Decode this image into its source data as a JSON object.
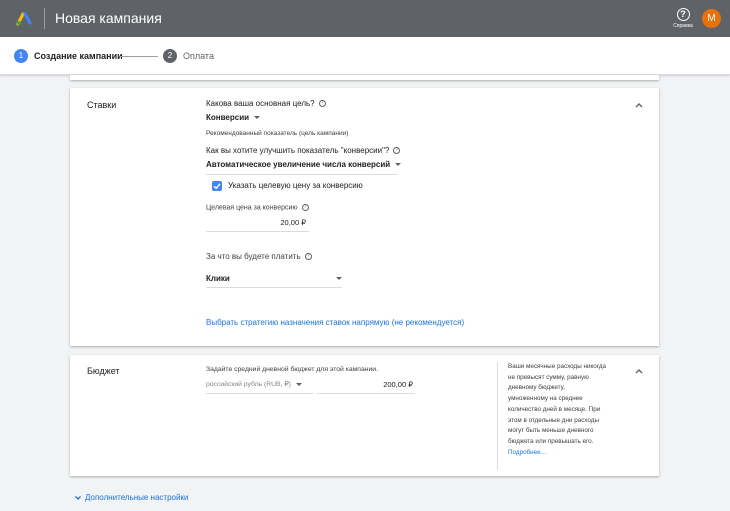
{
  "header": {
    "title": "Новая кампания",
    "help_label": "Справка",
    "avatar_letter": "M",
    "help_glyph": "?"
  },
  "stepper": {
    "steps": [
      {
        "number": "1",
        "label": "Создание кампании"
      },
      {
        "number": "2",
        "label": "Оплата"
      }
    ]
  },
  "bids": {
    "title": "Ставки",
    "goal_question": "Какова ваша основная цель?",
    "goal_value": "Конверсии",
    "recommended_label": "Рекомендованный показатель (цель кампании)",
    "improve_question": "Как вы хотите улучшить показатель \"конверсии\"?",
    "improve_value": "Автоматическое увеличение числа конверсий",
    "target_cpa_checkbox": "Указать целевую цену за конверсию",
    "target_cpa_label": "Целевая цена за конверсию",
    "target_cpa_value": "20,00 ₽",
    "pay_for_question": "За что вы будете платить",
    "pay_for_value": "Клики",
    "strategy_link": "Выбрать стратегию назначения ставок напрямую (не рекомендуется)"
  },
  "budget": {
    "title": "Бюджет",
    "prompt": "Задайте средний дневной бюджет для этой кампании.",
    "currency": "российский рубль (RUB, ₽)",
    "amount": "200,00 ₽",
    "note_lines": [
      "Ваши месячные расходы никогда",
      "не превысят сумму, равную",
      "дневному бюджету,",
      "умноженному на среднее",
      "количество дней в месяце. При",
      "этом в отдельные дни расходы",
      "могут быть меньше дневного",
      "бюджета или превышать его."
    ],
    "more_link": "Подробнее…"
  },
  "additional_settings": "Дополнительные настройки",
  "colors": {
    "header_bg": "#5f6368",
    "accent_blue": "#4285f4",
    "link_blue": "#1a73e8",
    "avatar_orange": "#e8710a",
    "page_bg": "#f1f3f4"
  },
  "icons": {
    "logo": "google-ads-logo-icon",
    "help": "help-circle-icon",
    "collapse": "chevron-up-icon",
    "info": "info-circle-icon",
    "dropdown": "caret-down-icon",
    "checkbox": "checkbox-checked-icon",
    "expand": "chevron-down-icon"
  }
}
